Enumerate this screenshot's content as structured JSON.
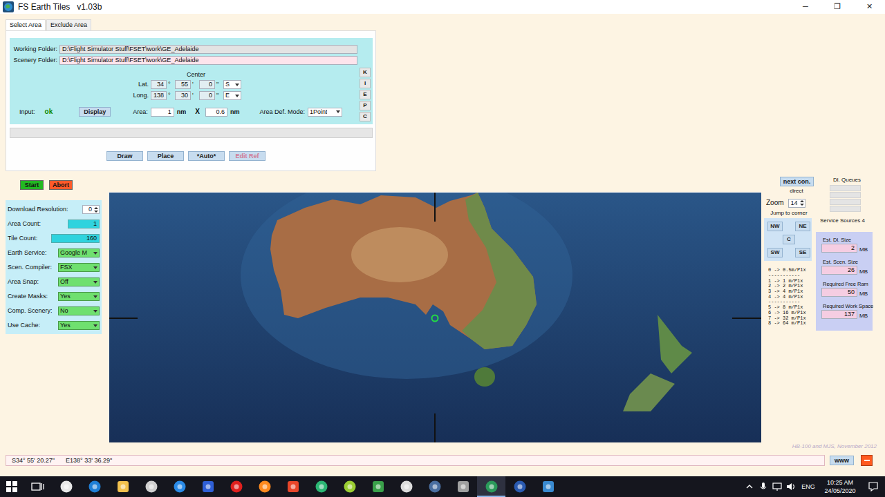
{
  "window": {
    "title": "FS Earth Tiles   v1.03b",
    "controls": [
      "─",
      "❐",
      "✕"
    ]
  },
  "tabs": [
    {
      "label": "Select Area",
      "selected": true
    },
    {
      "label": "Exclude Area",
      "selected": false
    }
  ],
  "folders": [
    {
      "label": "Working Folder:",
      "value": "D:\\Flight Simulator Stuff\\FSET\\work\\GE_Adelaide",
      "kind": "working"
    },
    {
      "label": "Scenery Folder:",
      "value": "D:\\Flight Simulator Stuff\\FSET\\work\\GE_Adelaide",
      "kind": "scenery"
    }
  ],
  "center": {
    "label": "Center",
    "symbols": [
      "°",
      "'",
      "\""
    ],
    "rows": [
      {
        "label": "Lat.",
        "deg": "34",
        "min": "55",
        "sec": "0",
        "hemisphere": "S"
      },
      {
        "label": "Long.",
        "deg": "138",
        "min": "30",
        "sec": "0",
        "hemisphere": "E"
      }
    ]
  },
  "input": {
    "label": "Input:",
    "status": "ok"
  },
  "display_button": "Display",
  "area": {
    "label": "Area:",
    "width": "1",
    "height": "0.6",
    "unit": "nm",
    "times": "X"
  },
  "area_def_mode": {
    "label": "Area Def. Mode:",
    "value": "1Point"
  },
  "side_buttons": [
    "K",
    "I",
    "E",
    "P",
    "C"
  ],
  "progress": {
    "level": 0
  },
  "action_buttons": [
    {
      "label": "Draw",
      "disabled": false
    },
    {
      "label": "Place",
      "disabled": false
    },
    {
      "label": "*Auto*",
      "disabled": false
    },
    {
      "label": "Edit Ref",
      "disabled": true
    }
  ],
  "run_buttons": [
    {
      "label": "Start",
      "color": "#22b822"
    },
    {
      "label": "Abort",
      "color": "#ff5a2a"
    }
  ],
  "settings": [
    {
      "label": "Download Resolution:",
      "value": "0",
      "kind": "spinner"
    },
    {
      "label": "Area Count:",
      "value": "1",
      "kind": "count"
    },
    {
      "label": "Tile Count:",
      "value": "160",
      "kind": "count"
    },
    {
      "label": "Earth Service:",
      "value": "Google M",
      "kind": "select"
    },
    {
      "label": "Scen. Compiler:",
      "value": "FSX",
      "kind": "select"
    },
    {
      "label": "Area Snap:",
      "value": "Off",
      "kind": "select"
    },
    {
      "label": "Create Masks:",
      "value": "Yes",
      "kind": "select"
    },
    {
      "label": "Comp. Scenery:",
      "value": "No",
      "kind": "select"
    },
    {
      "label": "Use Cache:",
      "value": "Yes",
      "kind": "select"
    }
  ],
  "connection": {
    "button": "next con.",
    "mode": "direct"
  },
  "zoom": {
    "label": "Zoom",
    "value": "14"
  },
  "jump": {
    "label": "Jump to corner",
    "buttons": [
      "NW",
      "NE",
      "C",
      "SW",
      "SE"
    ]
  },
  "resolution_legend": [
    "0 -> 0.5m/P1x",
    "-----------",
    "1 -> 1 m/P1x",
    "2 -> 2 m/P1x",
    "3 -> 4 m/P1x",
    "4 -> 4 m/P1x",
    "-----------",
    "5 -> 8 m/P1x",
    "6 -> 16 m/P1x",
    "7 -> 32 m/P1x",
    "8 -> 64 m/P1x"
  ],
  "queues": {
    "label": "Dl. Queues",
    "slots": [
      {
        "busy": false
      },
      {
        "busy": false
      },
      {
        "busy": false
      },
      {
        "busy": false
      }
    ]
  },
  "service_sources": "Service Sources 4",
  "estimates": [
    {
      "label": "Est. Dl. Size",
      "value": "2",
      "unit": "MB"
    },
    {
      "label": "Est. Scen. Size",
      "value": "26",
      "unit": "MB"
    },
    {
      "label": "Required Free Ram",
      "value": "50",
      "unit": "MB"
    },
    {
      "label": "Required Work Space",
      "value": "137",
      "unit": "MB"
    }
  ],
  "credit": "HB-100 and MJS, November 2012",
  "status_bar": {
    "latitude": "S34° 55' 20.27\"",
    "longitude": "E138° 33' 36.29\"",
    "www_button": "www"
  },
  "taskbar": {
    "apps": [
      {
        "color": "#e8e8e8",
        "selected": false
      },
      {
        "color": "#1f7fd6",
        "selected": false
      },
      {
        "color": "#f2c14e",
        "selected": false
      },
      {
        "color": "#d0d0d0",
        "selected": false
      },
      {
        "color": "#2a8ae6",
        "selected": false
      },
      {
        "color": "#2f5fd6",
        "selected": false
      },
      {
        "color": "#e0201e",
        "selected": false
      },
      {
        "color": "#ff8a1e",
        "selected": false
      },
      {
        "color": "#e8462a",
        "selected": false
      },
      {
        "color": "#2bb673",
        "selected": false
      },
      {
        "color": "#9acd32",
        "selected": false
      },
      {
        "color": "#3aa04a",
        "selected": false
      },
      {
        "color": "#dcdcdc",
        "selected": false
      },
      {
        "color": "#4a6ea0",
        "selected": false
      },
      {
        "color": "#a0a0a0",
        "selected": false
      },
      {
        "color": "#2a9a5a",
        "selected": true
      },
      {
        "color": "#2a5ab0",
        "selected": false
      },
      {
        "color": "#3a8ad0",
        "selected": false
      }
    ],
    "language": "ENG",
    "time": "10:25 AM",
    "date": "24/05/2020"
  }
}
